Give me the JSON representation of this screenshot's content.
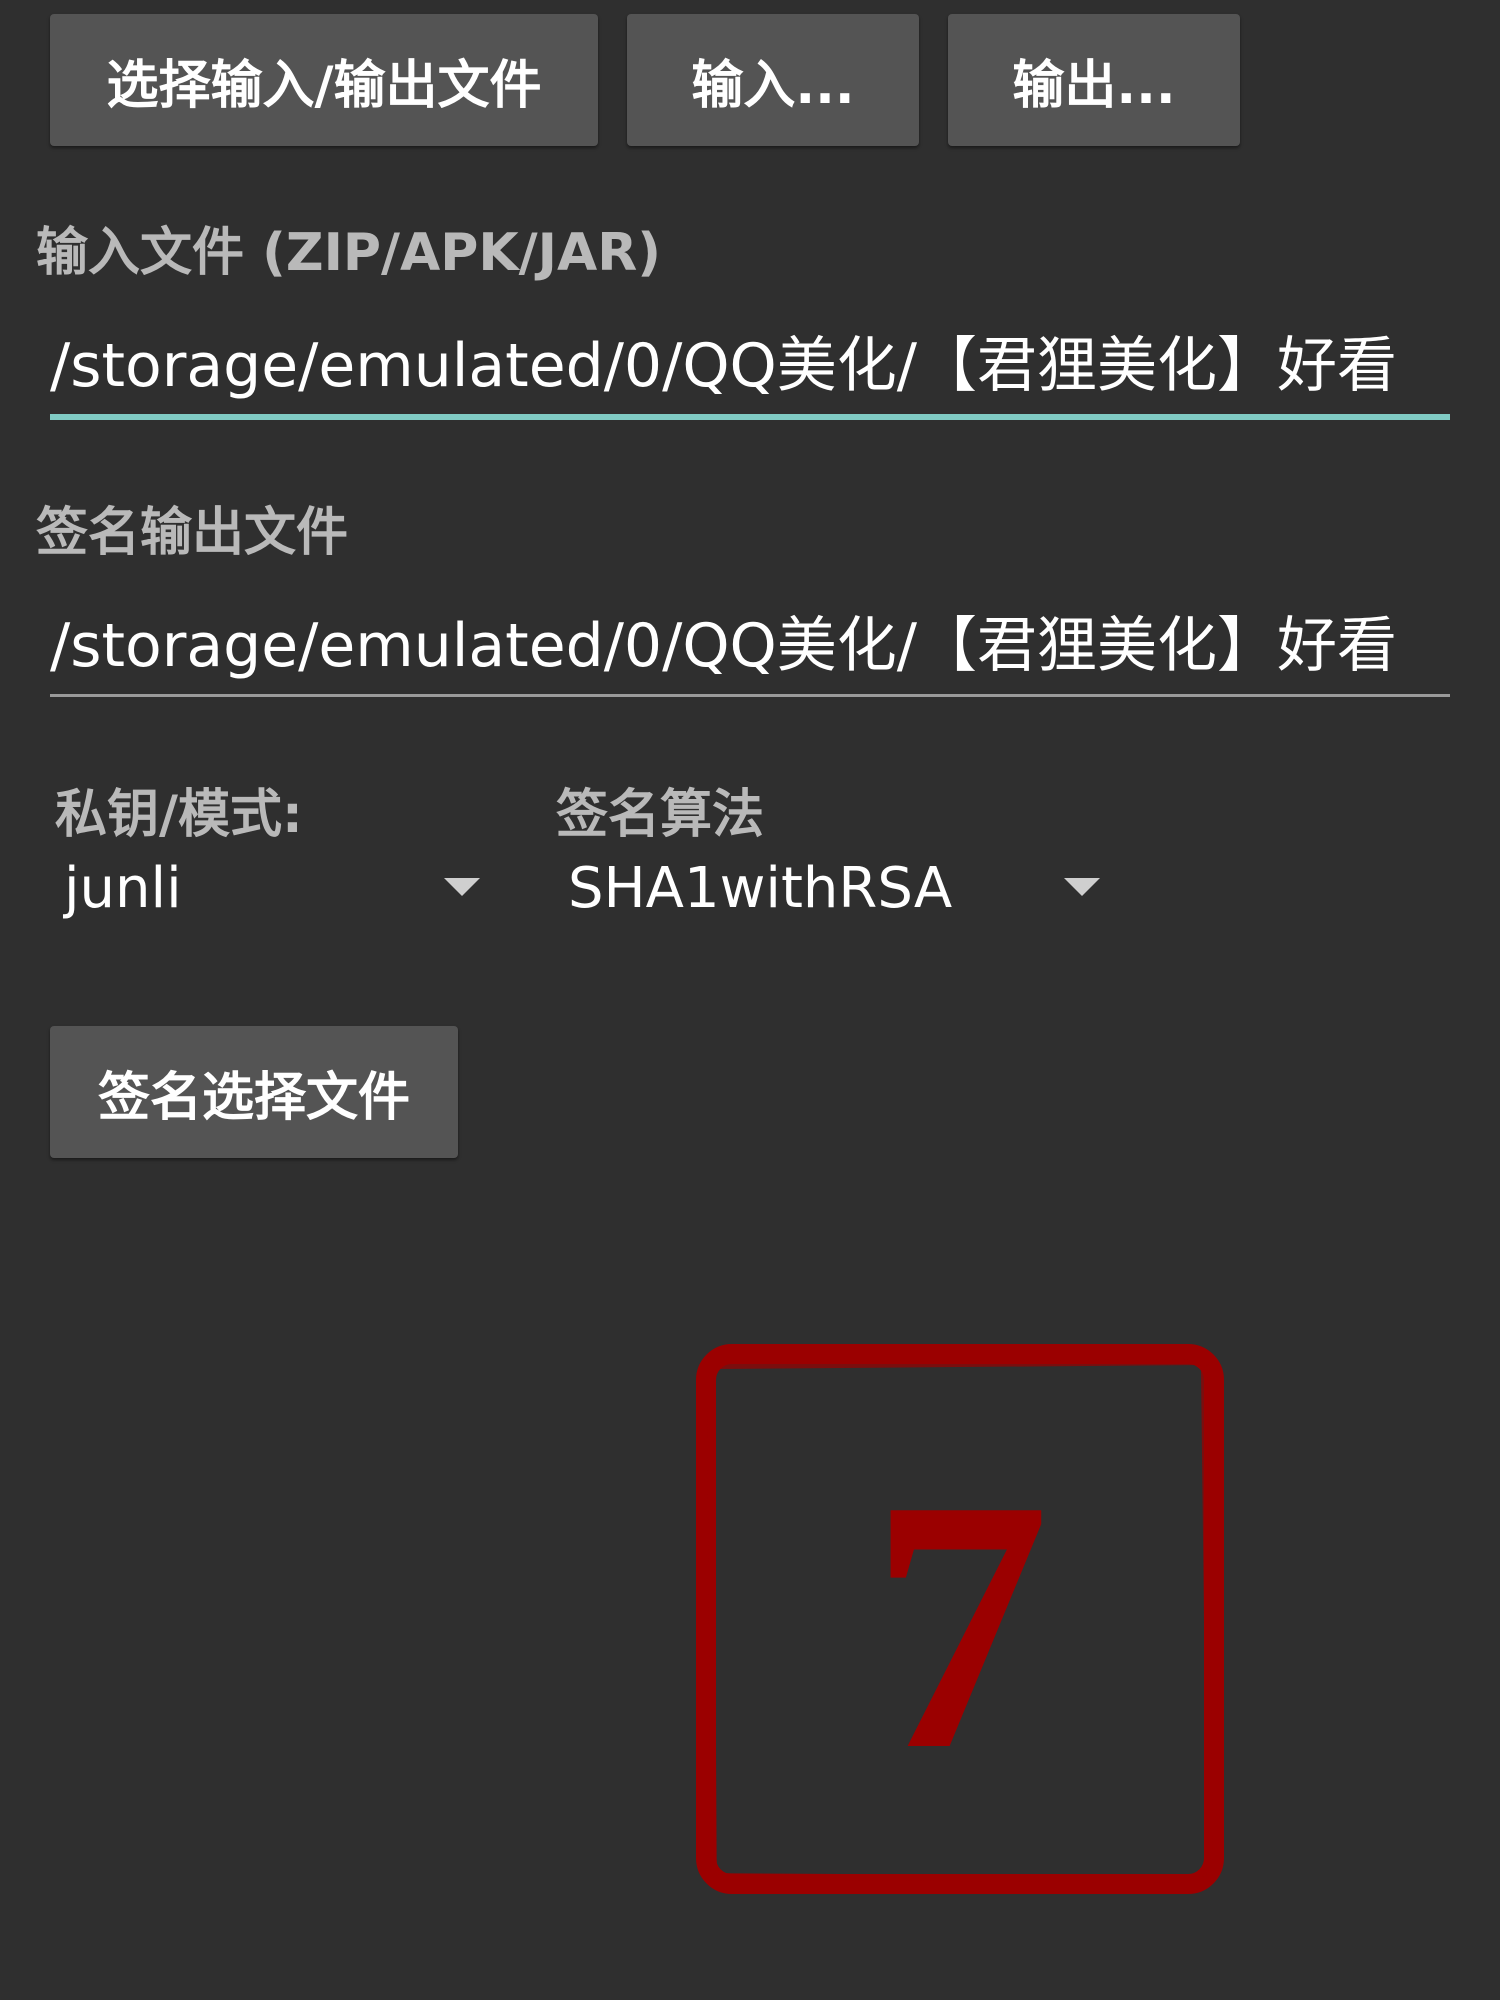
{
  "buttons": {
    "select_io": "选择输入/输出文件",
    "input": "输入...",
    "output": "输出...",
    "sign_selected": "签名选择文件"
  },
  "input_file": {
    "label": "输入文件 (ZIP/APK/JAR)",
    "value": "/storage/emulated/0/QQ美化/【君狸美化】好看"
  },
  "output_file": {
    "label": "签名输出文件",
    "value": "/storage/emulated/0/QQ美化/【君狸美化】好看"
  },
  "key_mode": {
    "label": "私钥/模式:",
    "selected": "junli"
  },
  "sign_algorithm": {
    "label": "签名算法",
    "selected": "SHA1withRSA"
  },
  "stamp": {
    "text": "7",
    "color": "#9b0000"
  },
  "colors": {
    "background": "#2f2f2f",
    "button": "#545454",
    "accent_underline": "#80cbc4"
  }
}
